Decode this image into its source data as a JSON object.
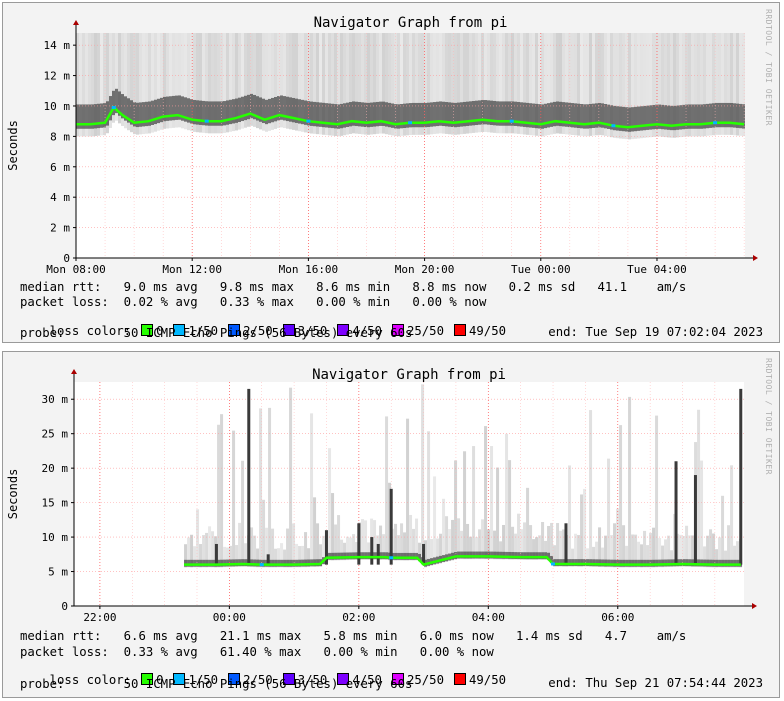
{
  "watermark": "RRDTOOL / TOBI OETIKER",
  "loss_colors": [
    {
      "label": "0",
      "color": "#26ff00"
    },
    {
      "label": "1/50",
      "color": "#00b8ff"
    },
    {
      "label": "2/50",
      "color": "#0059ff"
    },
    {
      "label": "3/50",
      "color": "#5e00ff"
    },
    {
      "label": "4/50",
      "color": "#7e00ff"
    },
    {
      "label": "25/50",
      "color": "#dd00ff"
    },
    {
      "label": "49/50",
      "color": "#ff0000"
    }
  ],
  "graphs": [
    {
      "title": "Navigator Graph from pi",
      "ylabel": "Seconds",
      "median_rtt": "median rtt:   9.0 ms avg   9.8 ms max   8.6 ms min   8.8 ms now   0.2 ms sd   41.1    am/s",
      "packet_loss": "packet loss:  0.02 % avg   0.33 % max   0.00 % min   0.00 % now",
      "loss_color_label": "loss color:",
      "probe": "probe:        50 ICMP Echo Pings (56 Bytes) every 60s",
      "end": "end: Tue Sep 19 07:02:04 2023"
    },
    {
      "title": "Navigator Graph from pi",
      "ylabel": "Seconds",
      "median_rtt": "median rtt:   6.6 ms avg   21.1 ms max   5.8 ms min   6.0 ms now   1.4 ms sd   4.7    am/s",
      "packet_loss": "packet loss:  0.33 % avg   61.40 % max   0.00 % min   0.00 % now",
      "loss_color_label": "loss color:",
      "probe": "probe:        50 ICMP Echo Pings (56 Bytes) every 60s",
      "end": "end: Thu Sep 21 07:54:44 2023"
    }
  ],
  "chart_data": [
    {
      "type": "area",
      "title": "Navigator Graph from pi",
      "ylabel": "Seconds",
      "y_ticks": [
        "0",
        "2 m",
        "4 m",
        "6 m",
        "8 m",
        "10 m",
        "12 m",
        "14 m"
      ],
      "y_tick_values": [
        0,
        2,
        4,
        6,
        8,
        10,
        12,
        14
      ],
      "ylim": [
        0,
        14.8
      ],
      "x_ticks": [
        "Mon 08:00",
        "Mon 12:00",
        "Mon 16:00",
        "Mon 20:00",
        "Tue 00:00",
        "Tue 04:00"
      ],
      "x_tick_hours": [
        8,
        12,
        16,
        20,
        24,
        28
      ],
      "xlim_hours": [
        8,
        31.03
      ],
      "grid": true,
      "series": [
        {
          "name": "median rtt",
          "x": [
            8,
            8.5,
            9,
            9.3,
            9.6,
            10,
            10.5,
            11,
            11.5,
            12,
            12.5,
            13,
            13.5,
            14,
            14.5,
            15,
            15.5,
            16,
            16.5,
            17,
            17.5,
            18,
            18.5,
            19,
            19.5,
            20,
            20.5,
            21,
            21.5,
            22,
            22.5,
            23,
            23.5,
            24,
            24.5,
            25,
            25.5,
            26,
            26.5,
            27,
            27.5,
            28,
            28.5,
            29,
            29.5,
            30,
            30.5,
            31
          ],
          "y": [
            8.8,
            8.8,
            8.9,
            9.9,
            9.4,
            8.9,
            9.0,
            9.3,
            9.4,
            9.1,
            9.0,
            9.0,
            9.2,
            9.5,
            9.1,
            9.4,
            9.2,
            9.0,
            8.9,
            8.8,
            9.0,
            8.9,
            9.0,
            8.8,
            8.9,
            8.9,
            9.0,
            8.9,
            9.0,
            9.1,
            9.0,
            9.0,
            8.9,
            8.8,
            9.0,
            8.9,
            8.8,
            8.9,
            8.7,
            8.6,
            8.7,
            8.8,
            8.7,
            8.8,
            8.8,
            8.9,
            8.9,
            8.8
          ]
        }
      ]
    },
    {
      "type": "area",
      "title": "Navigator Graph from pi",
      "ylabel": "Seconds",
      "y_ticks": [
        "0",
        "5 m",
        "10 m",
        "15 m",
        "20 m",
        "25 m",
        "30 m"
      ],
      "y_tick_values": [
        0,
        5,
        10,
        15,
        20,
        25,
        30
      ],
      "ylim": [
        0,
        32.5
      ],
      "x_ticks": [
        "22:00",
        "00:00",
        "02:00",
        "04:00",
        "06:00"
      ],
      "x_tick_hours": [
        22,
        24,
        26,
        28,
        30
      ],
      "xlim_hours": [
        21.6,
        31.95
      ],
      "grid": true,
      "series": [
        {
          "name": "median rtt",
          "x": [
            23.3,
            23.8,
            24.2,
            24.5,
            24.6,
            25.0,
            25.4,
            25.5,
            26.0,
            26.4,
            26.5,
            26.9,
            27.0,
            27.5,
            28.0,
            28.5,
            28.9,
            29.0,
            29.5,
            30.0,
            30.5,
            31.0,
            31.5,
            31.9
          ],
          "y": [
            6.0,
            6.0,
            6.1,
            6.0,
            6.0,
            6.0,
            6.1,
            7.0,
            7.1,
            7.1,
            7.0,
            7.0,
            6.0,
            7.2,
            7.2,
            7.1,
            7.1,
            6.1,
            6.1,
            6.0,
            6.0,
            6.1,
            6.0,
            6.0
          ]
        },
        {
          "name": "spikes",
          "x": [
            23.8,
            24.3,
            24.6,
            25.5,
            26.0,
            26.2,
            26.3,
            26.5,
            27.0,
            29.2,
            30.9,
            31.2,
            31.9
          ],
          "y": [
            9,
            31.5,
            7.5,
            11,
            12,
            10,
            9,
            17,
            9,
            12,
            21,
            19,
            31.5
          ]
        }
      ]
    }
  ]
}
